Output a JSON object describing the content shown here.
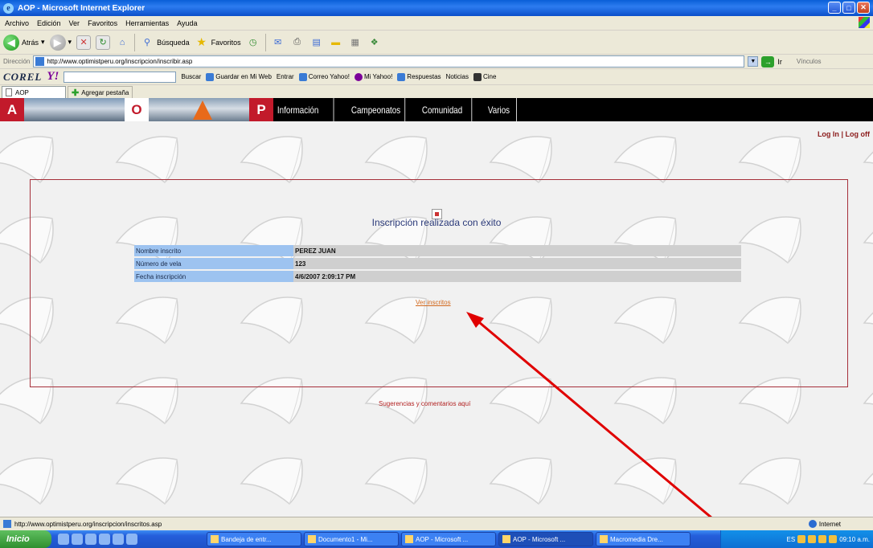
{
  "window": {
    "title": "AOP - Microsoft Internet Explorer",
    "buttons": [
      "_",
      "□",
      "✕"
    ]
  },
  "menu": [
    "Archivo",
    "Edición",
    "Ver",
    "Favoritos",
    "Herramientas",
    "Ayuda"
  ],
  "toolbar": {
    "back_label": "Atrás",
    "search_label": "Búsqueda",
    "favorites_label": "Favoritos"
  },
  "address": {
    "label": "Dirección",
    "url": "http://www.optimistperu.org/inscripcion/inscribir.asp",
    "go_label": "Ir",
    "links_label": "Vínculos"
  },
  "yahoo_bar": {
    "brand": "COREL",
    "logo": "Y!",
    "items": [
      "Buscar",
      "Guardar en Mi Web",
      "Entrar",
      "Correo Yahoo!",
      "Mi Yahoo!",
      "Respuestas",
      "Noticias",
      "Cine"
    ]
  },
  "tabs": {
    "current": "AOP",
    "new_tab": "Agregar pestaña"
  },
  "site": {
    "logo_letters": [
      "A",
      "O",
      "P"
    ],
    "nav": [
      "Información",
      "Campeonatos",
      "Comunidad",
      "Varios"
    ],
    "login": "Log In",
    "logoff": "Log off",
    "sep": "|",
    "success_message": "Inscripción realizada con éxito",
    "fields": [
      {
        "label": "Nombre inscrito",
        "value": "PEREZ JUAN"
      },
      {
        "label": "Número de vela",
        "value": "123"
      },
      {
        "label": "Fecha inscripción",
        "value": "4/6/2007 2:09:17 PM"
      }
    ],
    "view_link": "Ver inscritos",
    "suggestions_link": "Sugerencias y comentarios aquí"
  },
  "status": {
    "url": "http://www.optimistperu.org/inscripcion/inscritos.asp",
    "zone": "Internet"
  },
  "taskbar": {
    "start": "Inicio",
    "tasks": [
      "Bandeja de entr...",
      "Documento1 - Mi...",
      "AOP - Microsoft ...",
      "AOP - Microsoft ...",
      "Macromedia Dre..."
    ],
    "tray_lang": "ES",
    "clock": "09:10 a.m."
  },
  "colors": {
    "accent_red": "#c21a2b",
    "nav_bg": "#000000",
    "label_cell": "#9dc3f0",
    "value_cell": "#cfcfcf",
    "annotation_arrow": "#e00000"
  }
}
